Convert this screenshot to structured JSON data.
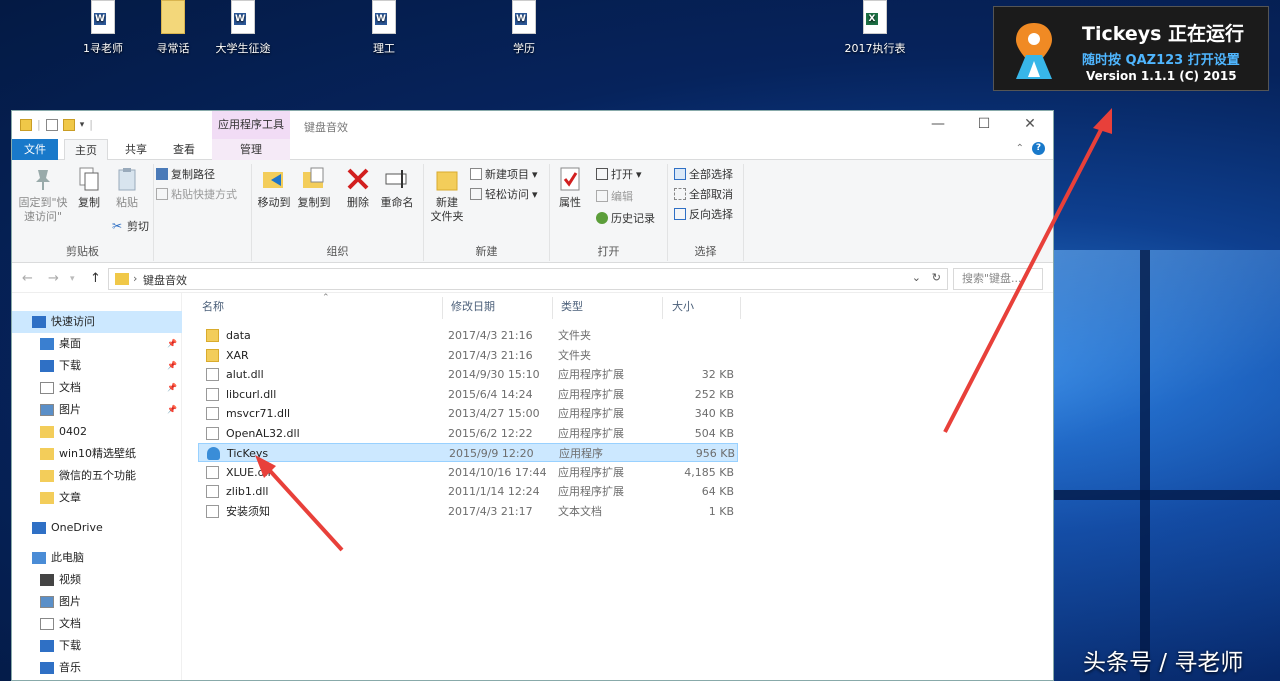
{
  "desktop": {
    "icons": [
      {
        "label": "1寻老师",
        "kind": "word"
      },
      {
        "label": "寻常话",
        "kind": "folder"
      },
      {
        "label": "大学生征途",
        "kind": "word"
      },
      {
        "label": "理工",
        "kind": "word"
      },
      {
        "label": "学历",
        "kind": "word"
      },
      {
        "label": "2017执行表",
        "kind": "excel"
      }
    ]
  },
  "toast": {
    "title": "Tickeys 正在运行",
    "subtitle": "随时按 QAZ123 打开设置",
    "version": "Version 1.1.1 (C) 2015",
    "accent": "#4fb6ff"
  },
  "window": {
    "context_tab": "应用程序工具",
    "title": "键盘音效",
    "controls": {
      "minimize": "—",
      "maximize": "☐",
      "close": "✕"
    },
    "tabs": {
      "file": "文件",
      "home": "主页",
      "share": "共享",
      "view": "查看",
      "manage": "管理"
    },
    "help": "?",
    "ribbon": {
      "clipboard": {
        "pin": "固定到\"快速访问\"",
        "copy": "复制",
        "paste": "粘贴",
        "copy_path": "复制路径",
        "paste_shortcut": "粘贴快捷方式",
        "cut": "剪切",
        "label": "剪贴板"
      },
      "organize": {
        "move_to": "移动到",
        "copy_to": "复制到",
        "delete": "删除",
        "rename": "重命名",
        "label": "组织"
      },
      "new": {
        "new_folder": "新建\n文件夹",
        "new_item": "新建项目",
        "easy_access": "轻松访问",
        "label": "新建"
      },
      "open": {
        "properties": "属性",
        "open": "打开",
        "edit": "编辑",
        "history": "历史记录",
        "label": "打开"
      },
      "select": {
        "select_all": "全部选择",
        "select_none": "全部取消",
        "invert": "反向选择",
        "label": "选择"
      }
    },
    "address": {
      "back": "←",
      "forward": "→",
      "up": "↑",
      "path": "键盘音效",
      "search_placeholder": "搜索\"键盘..."
    },
    "nav": [
      {
        "label": "快速访问",
        "icon": "star-icon",
        "indent": 1,
        "selected": true,
        "pin": false
      },
      {
        "label": "桌面",
        "icon": "desktop-icon",
        "indent": 2,
        "pin": true
      },
      {
        "label": "下载",
        "icon": "download-icon",
        "indent": 2,
        "pin": true
      },
      {
        "label": "文档",
        "icon": "document-icon",
        "indent": 2,
        "pin": true
      },
      {
        "label": "图片",
        "icon": "picture-icon",
        "indent": 2,
        "pin": true
      },
      {
        "label": "0402",
        "icon": "folder-icon",
        "indent": 2,
        "pin": false
      },
      {
        "label": "win10精选壁纸",
        "icon": "folder-icon",
        "indent": 2,
        "pin": false
      },
      {
        "label": "微信的五个功能",
        "icon": "folder-icon",
        "indent": 2,
        "pin": false
      },
      {
        "label": "文章",
        "icon": "folder-icon",
        "indent": 2,
        "pin": false
      },
      {
        "label": "OneDrive",
        "icon": "cloud-icon",
        "indent": 1,
        "pin": false,
        "gap": true
      },
      {
        "label": "此电脑",
        "icon": "computer-icon",
        "indent": 1,
        "pin": false,
        "gap": true
      },
      {
        "label": "视频",
        "icon": "video-icon",
        "indent": 2,
        "pin": false
      },
      {
        "label": "图片",
        "icon": "picture-icon",
        "indent": 2,
        "pin": false
      },
      {
        "label": "文档",
        "icon": "document-icon",
        "indent": 2,
        "pin": false
      },
      {
        "label": "下载",
        "icon": "download-icon",
        "indent": 2,
        "pin": false
      },
      {
        "label": "音乐",
        "icon": "music-icon",
        "indent": 2,
        "pin": false
      }
    ],
    "columns": {
      "name": "名称",
      "date": "修改日期",
      "type": "类型",
      "size": "大小"
    },
    "files": [
      {
        "name": "data",
        "date": "2017/4/3 21:16",
        "type": "文件夹",
        "size": "",
        "kind": "folder"
      },
      {
        "name": "XAR",
        "date": "2017/4/3 21:16",
        "type": "文件夹",
        "size": "",
        "kind": "folder"
      },
      {
        "name": "alut.dll",
        "date": "2014/9/30 15:10",
        "type": "应用程序扩展",
        "size": "32 KB",
        "kind": "file"
      },
      {
        "name": "libcurl.dll",
        "date": "2015/6/4 14:24",
        "type": "应用程序扩展",
        "size": "252 KB",
        "kind": "file"
      },
      {
        "name": "msvcr71.dll",
        "date": "2013/4/27 15:00",
        "type": "应用程序扩展",
        "size": "340 KB",
        "kind": "file"
      },
      {
        "name": "OpenAL32.dll",
        "date": "2015/6/2 12:22",
        "type": "应用程序扩展",
        "size": "504 KB",
        "kind": "file"
      },
      {
        "name": "TicKeys",
        "date": "2015/9/9 12:20",
        "type": "应用程序",
        "size": "956 KB",
        "kind": "app",
        "selected": true
      },
      {
        "name": "XLUE.dll",
        "date": "2014/10/16 17:44",
        "type": "应用程序扩展",
        "size": "4,185 KB",
        "kind": "file"
      },
      {
        "name": "zlib1.dll",
        "date": "2011/1/14 12:24",
        "type": "应用程序扩展",
        "size": "64 KB",
        "kind": "file"
      },
      {
        "name": "安装须知",
        "date": "2017/4/3 21:17",
        "type": "文本文档",
        "size": "1 KB",
        "kind": "txt"
      }
    ]
  },
  "watermark": "头条号 / 寻老师",
  "annotation_color": "#e8403a"
}
